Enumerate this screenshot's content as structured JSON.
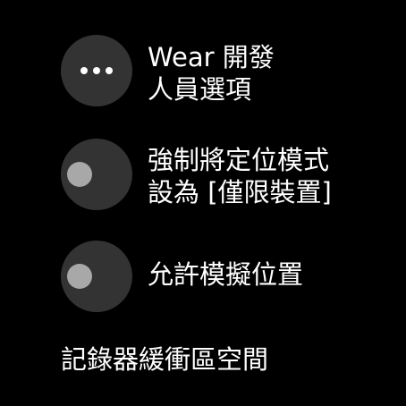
{
  "items": [
    {
      "icon": "more-horiz-icon",
      "line1": "Wear 開發",
      "line2": "人員選項"
    },
    {
      "icon": "toggle-off-icon",
      "toggle_on": false,
      "line1": "強制將定位模式",
      "line2": "設為 [僅限裝置]"
    },
    {
      "icon": "toggle-off-icon",
      "toggle_on": false,
      "line1": "允許模擬位置"
    }
  ],
  "bottom_item": {
    "label": "記錄器緩衝區空間"
  },
  "colors": {
    "background": "#000000",
    "icon_circle": "#333333",
    "toggle_knob_off": "#a8a8a8",
    "text": "#ffffff"
  }
}
